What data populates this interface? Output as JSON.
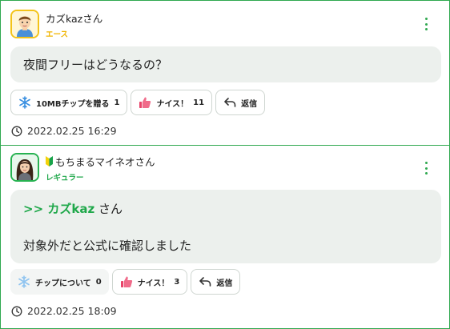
{
  "posts": [
    {
      "user_name": "カズkazさん",
      "rank": "エース",
      "message": "夜間フリーはどうなるの？",
      "actions": {
        "chip_label": "10MBチップを贈る",
        "chip_count": "1",
        "nice_label": "ナイス！",
        "nice_count": "11",
        "reply_label": "返信"
      },
      "timestamp": "2022.02.25 16:29"
    },
    {
      "user_name": "もちまるマイネオさん",
      "rank": "レギュラー",
      "reply_prefix": ">> カズkaz",
      "reply_suffix": " さん",
      "message": "対象外だと公式に確認しました",
      "actions": {
        "chip_label": "チップについて",
        "chip_count": "0",
        "nice_label": "ナイス！",
        "nice_count": "3",
        "reply_label": "返信"
      },
      "timestamp": "2022.02.25 18:09"
    }
  ],
  "icons": {
    "chip": "snowflake-icon",
    "nice": "thumbs-up-icon",
    "reply": "reply-arrow-icon",
    "time": "clock-icon",
    "menu": "kebab-menu-icon",
    "beginner": "beginner-mark-icon"
  },
  "colors": {
    "accent_green": "#2fa84f",
    "ace_gold": "#f0b400",
    "regular_green": "#1fa84a",
    "bubble_bg": "#ecf0ed",
    "nice_pink": "#e8446a",
    "chip_blue": "#3a8fe0"
  }
}
